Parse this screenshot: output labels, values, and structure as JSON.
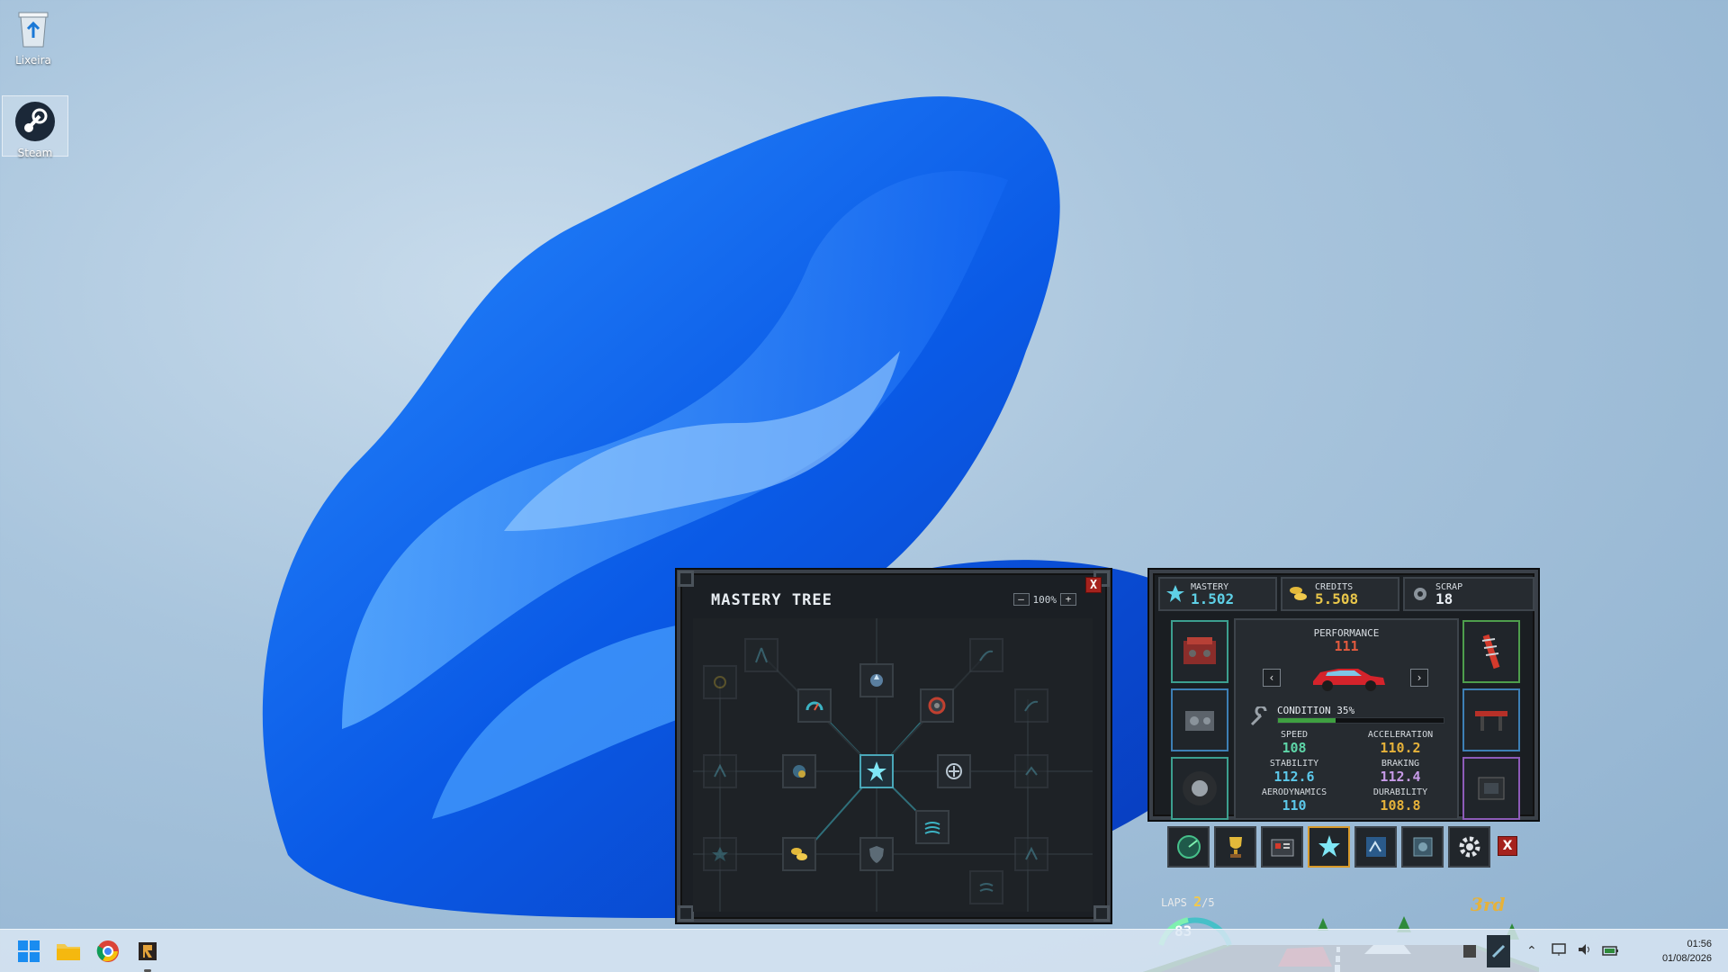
{
  "desktop": {
    "icons": [
      {
        "label": "Lixeira"
      },
      {
        "label": "Steam"
      }
    ]
  },
  "mastery_tree": {
    "title": "MASTERY TREE",
    "zoom": "100%",
    "zoom_out": "–",
    "zoom_in": "+",
    "close": "X"
  },
  "resources": {
    "mastery": {
      "label": "MASTERY",
      "value": "1.502"
    },
    "credits": {
      "label": "CREDITS",
      "value": "5.508"
    },
    "scrap": {
      "label": "SCRAP",
      "value": "18"
    }
  },
  "car": {
    "performance_label": "PERFORMANCE",
    "performance_value": "111",
    "prev": "‹",
    "next": "›",
    "condition_label": "CONDITION 35%",
    "condition": 0.35,
    "stats": [
      {
        "label": "SPEED",
        "value": "108",
        "color": "#5ed6a8"
      },
      {
        "label": "ACCELERATION",
        "value": "110.2",
        "color": "#e6b23a"
      },
      {
        "label": "STABILITY",
        "value": "112.6",
        "color": "#5cc8ea"
      },
      {
        "label": "BRAKING",
        "value": "112.4",
        "color": "#c79be8"
      },
      {
        "label": "AERODYNAMICS",
        "value": "110",
        "color": "#5cc8ea"
      },
      {
        "label": "DURABILITY",
        "value": "108.8",
        "color": "#e6b23a"
      }
    ]
  },
  "toolbar": {
    "close": "X",
    "buttons": [
      "radar-icon",
      "trophy-icon",
      "race-event-icon",
      "mastery-star-icon",
      "blueprint-icon",
      "storage-icon",
      "settings-gear-icon"
    ]
  },
  "race_hud": {
    "laps_label": "LAPS",
    "laps_current": "2",
    "laps_total": "/5",
    "speed": "83",
    "place": "3rd"
  },
  "taskbar": {
    "time": "01:56",
    "date": "01/08/2026"
  }
}
